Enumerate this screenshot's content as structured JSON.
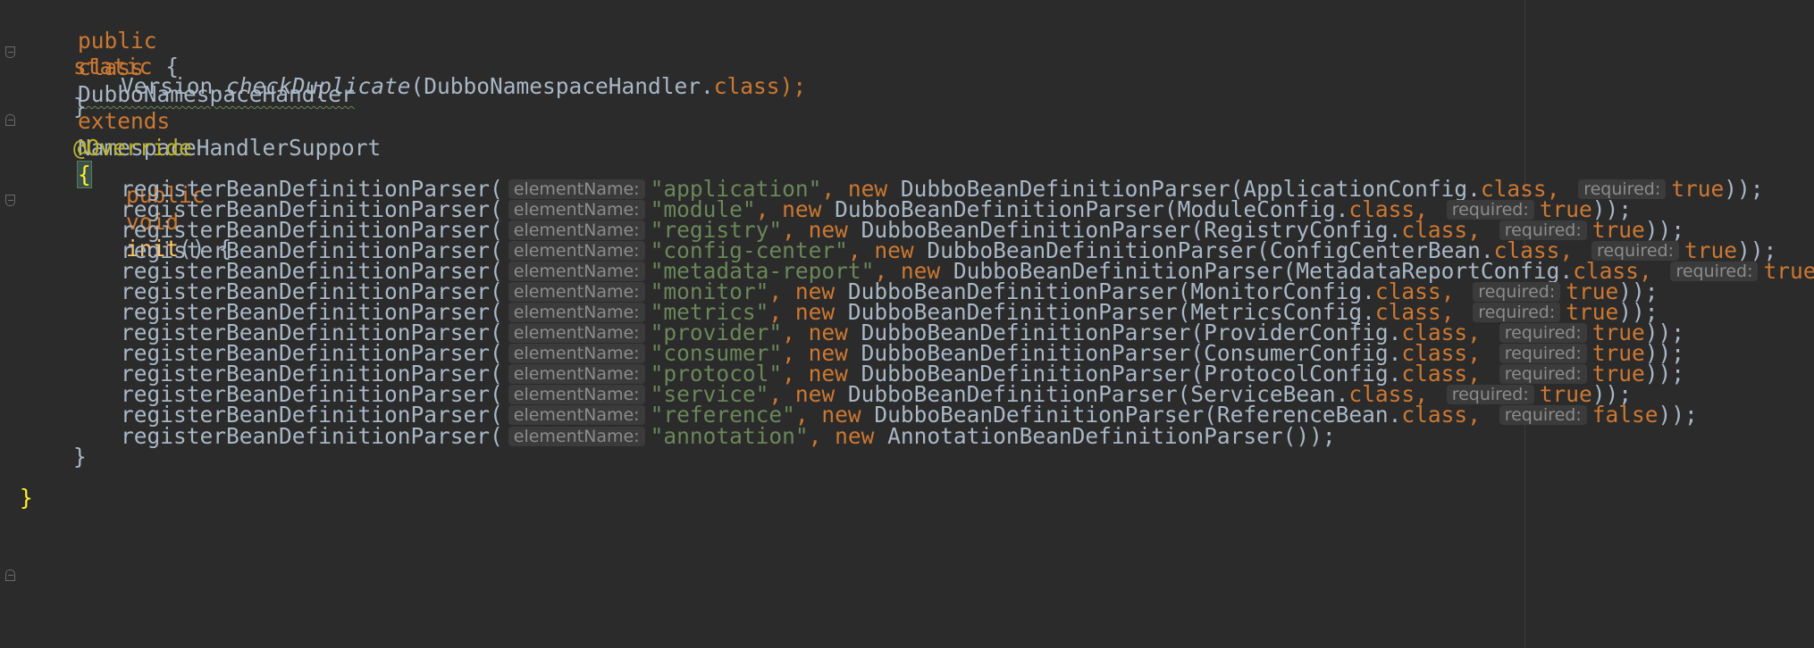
{
  "editor": {
    "class_decl": {
      "kw_public": "public",
      "kw_class": "class",
      "name": "DubboNamespaceHandler",
      "kw_extends": "extends",
      "super": "NamespaceHandlerSupport",
      "open_brace": "{"
    },
    "static_block": {
      "kw_static": "static",
      "open": " {",
      "call_obj": "Version.",
      "call_method": "checkDuplicate",
      "call_args_pre": "(DubboNamespaceHandler.",
      "kw_class": "class",
      "call_end": ");",
      "close": "}"
    },
    "init_method": {
      "annotation": "@Override",
      "kw_public": "public",
      "kw_void": "void",
      "name": "init",
      "sig_rest": "() {",
      "close": "}"
    },
    "call_name": "registerBeanDefinitionParser(",
    "hint_element": "elementName:",
    "hint_required": "required:",
    "kw_new": "new",
    "kw_class": "class",
    "parsers": [
      {
        "name": "\"application\"",
        "parser": "DubboBeanDefinitionParser(ApplicationConfig.",
        "required": "true"
      },
      {
        "name": "\"module\"",
        "parser": "DubboBeanDefinitionParser(ModuleConfig.",
        "required": "true"
      },
      {
        "name": "\"registry\"",
        "parser": "DubboBeanDefinitionParser(RegistryConfig.",
        "required": "true"
      },
      {
        "name": "\"config-center\"",
        "parser": "DubboBeanDefinitionParser(ConfigCenterBean.",
        "required": "true"
      },
      {
        "name": "\"metadata-report\"",
        "parser": "DubboBeanDefinitionParser(MetadataReportConfig.",
        "required": "true"
      },
      {
        "name": "\"monitor\"",
        "parser": "DubboBeanDefinitionParser(MonitorConfig.",
        "required": "true"
      },
      {
        "name": "\"metrics\"",
        "parser": "DubboBeanDefinitionParser(MetricsConfig.",
        "required": "true"
      },
      {
        "name": "\"provider\"",
        "parser": "DubboBeanDefinitionParser(ProviderConfig.",
        "required": "true"
      },
      {
        "name": "\"consumer\"",
        "parser": "DubboBeanDefinitionParser(ConsumerConfig.",
        "required": "true"
      },
      {
        "name": "\"protocol\"",
        "parser": "DubboBeanDefinitionParser(ProtocolConfig.",
        "required": "true"
      },
      {
        "name": "\"service\"",
        "parser": "DubboBeanDefinitionParser(ServiceBean.",
        "required": "true"
      },
      {
        "name": "\"reference\"",
        "parser": "DubboBeanDefinitionParser(ReferenceBean.",
        "required": "false"
      }
    ],
    "annotation_parser": {
      "name": "\"annotation\"",
      "parser": "AnnotationBeanDefinitionParser());"
    },
    "call_end": "));",
    "comma": ",",
    "class_close": "}"
  },
  "colors": {
    "background": "#2b2b2b",
    "keyword": "#cc7832",
    "string": "#6a8759",
    "annotation": "#bbb529",
    "declaration": "#ffc66d",
    "text": "#a9b7c6",
    "hint_bg": "#3b3b3b",
    "hint_text": "#8c8c8c",
    "brace_match": "#ffef28"
  }
}
